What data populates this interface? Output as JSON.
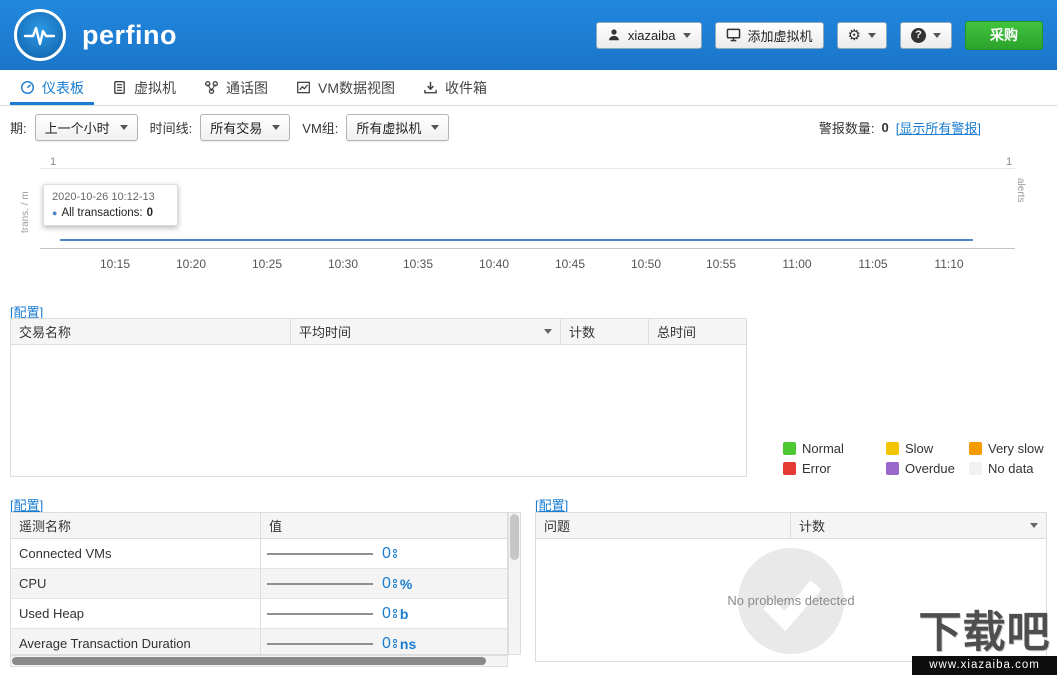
{
  "header": {
    "logo_text": "perfino",
    "user_button_label": "xiazaiba",
    "add_vm_label": "添加虚拟机",
    "buy_label": "采购"
  },
  "icons": {
    "gear_glyph": "⚙",
    "question_glyph": "?",
    "dot_glyph": "●"
  },
  "nav": {
    "tabs": [
      {
        "label": "仪表板"
      },
      {
        "label": "虚拟机"
      },
      {
        "label": "通话图"
      },
      {
        "label": "VM数据视图"
      },
      {
        "label": "收件箱"
      }
    ]
  },
  "filters": {
    "period_label": "期:",
    "period_value": "上一个小时",
    "timeline_label": "时间线:",
    "timeline_value": "所有交易",
    "vm_group_label": "VM组:",
    "vm_group_value": "所有虚拟机",
    "alerts_label": "警报数量:",
    "alerts_count": "0",
    "alerts_link": "[显示所有警报]"
  },
  "chart": {
    "y_left_label": "trans. / m",
    "y_right_label": "alerts",
    "y_left_max": "1",
    "y_right_max": "1",
    "tooltip_title": "2020-10-26 10:12-13",
    "tooltip_series": "All transactions:",
    "tooltip_value": "0",
    "x_labels": [
      "10:15",
      "10:20",
      "10:25",
      "10:30",
      "10:35",
      "10:40",
      "10:45",
      "10:50",
      "10:55",
      "11:00",
      "11:05",
      "11:10"
    ]
  },
  "chart_data": {
    "type": "line",
    "title": "",
    "x": [
      "10:15",
      "10:20",
      "10:25",
      "10:30",
      "10:35",
      "10:40",
      "10:45",
      "10:50",
      "10:55",
      "11:00",
      "11:05",
      "11:10"
    ],
    "series": [
      {
        "name": "All transactions",
        "axis": "left",
        "values": [
          0,
          0,
          0,
          0,
          0,
          0,
          0,
          0,
          0,
          0,
          0,
          0
        ]
      }
    ],
    "xlabel": "",
    "ylabel_left": "trans. / m",
    "ylabel_right": "alerts",
    "ylim_left": [
      0,
      1
    ],
    "ylim_right": [
      0,
      1
    ],
    "grid": true,
    "legend_position": "none",
    "tooltip": {
      "title": "2020-10-26 10:12-13",
      "series": "All transactions",
      "value": 0
    }
  },
  "transactions": {
    "config_link": "[配置]",
    "headers": [
      "交易名称",
      "平均时间",
      "计数",
      "总时间"
    ],
    "rows": []
  },
  "legend": {
    "items": [
      {
        "label": "Normal",
        "color": "#4cc832"
      },
      {
        "label": "Slow",
        "color": "#f2c500"
      },
      {
        "label": "Very slow",
        "color": "#f59b00"
      },
      {
        "label": "Error",
        "color": "#e53935"
      },
      {
        "label": "Overdue",
        "color": "#9966cc"
      },
      {
        "label": "No data",
        "color": "#f1f1f1"
      }
    ]
  },
  "telemetry": {
    "config_link": "[配置]",
    "headers": [
      "遥测名称",
      "值"
    ],
    "rows": [
      {
        "name": "Connected VMs",
        "value": "0",
        "unit": ""
      },
      {
        "name": "CPU",
        "value": "0",
        "unit": "%"
      },
      {
        "name": "Used Heap",
        "value": "0",
        "unit": "b"
      },
      {
        "name": "Average Transaction Duration",
        "value": "0",
        "unit": "ns"
      }
    ]
  },
  "problems": {
    "config_link": "[配置]",
    "headers": [
      "问题",
      "计数"
    ],
    "empty_message": "No problems detected"
  },
  "watermark": {
    "title": "下载吧",
    "url": "www.xiazaiba.com"
  },
  "colors": {
    "header_bg": "#1a7cd0",
    "accent_blue": "#1a7cd0",
    "buy_green": "#34b233",
    "chart_line": "#4a86c8"
  }
}
